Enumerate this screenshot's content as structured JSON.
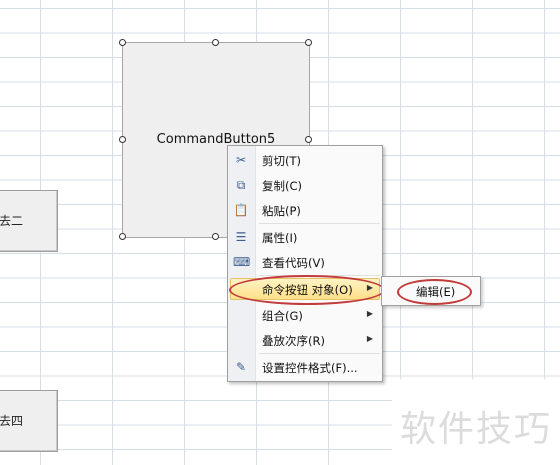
{
  "sheet_buttons": [
    {
      "label": "去二"
    },
    {
      "label": "去四"
    }
  ],
  "command_button": {
    "caption": "CommandButton5"
  },
  "context_menu": {
    "items": [
      {
        "label": "剪切(T)",
        "icon": "scissors-icon"
      },
      {
        "label": "复制(C)",
        "icon": "copy-icon"
      },
      {
        "label": "粘贴(P)",
        "icon": "paste-icon"
      },
      {
        "label": "属性(I)",
        "icon": "properties-icon"
      },
      {
        "label": "查看代码(V)",
        "icon": "view-code-icon"
      },
      {
        "label": "命令按钮 对象(O)",
        "icon": "",
        "submenu": true,
        "highlighted": true
      },
      {
        "label": "组合(G)",
        "icon": "",
        "submenu": true
      },
      {
        "label": "叠放次序(R)",
        "icon": "",
        "submenu": true
      },
      {
        "label": "设置控件格式(F)...",
        "icon": "format-control-icon"
      }
    ]
  },
  "submenu": {
    "items": [
      {
        "label": "编辑(E)"
      }
    ]
  },
  "watermark": {
    "text": "软件技巧"
  },
  "colors": {
    "highlight_ring": "#c33a3a",
    "menu_highlight": "#ffe08a"
  }
}
